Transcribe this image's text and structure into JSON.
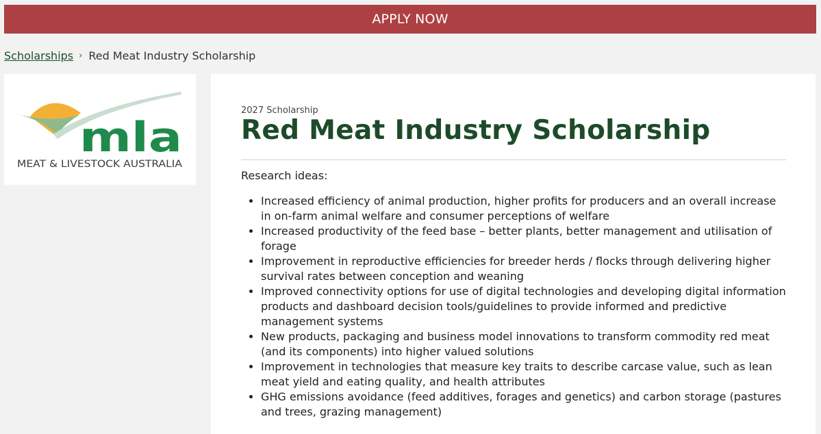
{
  "apply_button": {
    "label": "APPLY NOW"
  },
  "breadcrumb": {
    "parent_label": "Scholarships",
    "separator": "›",
    "current_label": "Red Meat Industry Scholarship"
  },
  "logo": {
    "wordmark": "mla",
    "tagline": "MEAT & LIVESTOCK AUSTRALIA",
    "colors": {
      "sun": "#f2b134",
      "hill": "#8dba8c",
      "swoosh": "#c9ddd0",
      "wordmark": "#1f8a4c",
      "tagline": "#3b3b3b"
    }
  },
  "main": {
    "eyebrow": "2027 Scholarship",
    "title": "Red Meat Industry Scholarship",
    "ideas_heading": "Research ideas:",
    "ideas": [
      "Increased efficiency of animal production, higher profits for producers and an overall increase in on-farm animal welfare and consumer perceptions of welfare",
      "Increased productivity of the feed base – better plants, better management and utilisation of forage",
      "Improvement in reproductive efficiencies for breeder herds / flocks through delivering higher survival rates between conception and weaning",
      "Improved connectivity options for use of digital technologies and developing digital information products and dashboard decision tools/guidelines to provide informed and predictive management systems",
      "New products, packaging and business model innovations to transform commodity red meat (and its components) into higher valued solutions",
      "Improvement in technologies that measure key traits to describe carcase value, such as lean meat yield and eating quality, and health attributes",
      "GHG emissions avoidance (feed additives, forages and genetics) and carbon storage (pastures and trees, grazing management)"
    ]
  },
  "theme": {
    "apply_bar_color": "#ad4043",
    "title_color": "#1d4b29",
    "page_background": "#f2f2f2"
  }
}
